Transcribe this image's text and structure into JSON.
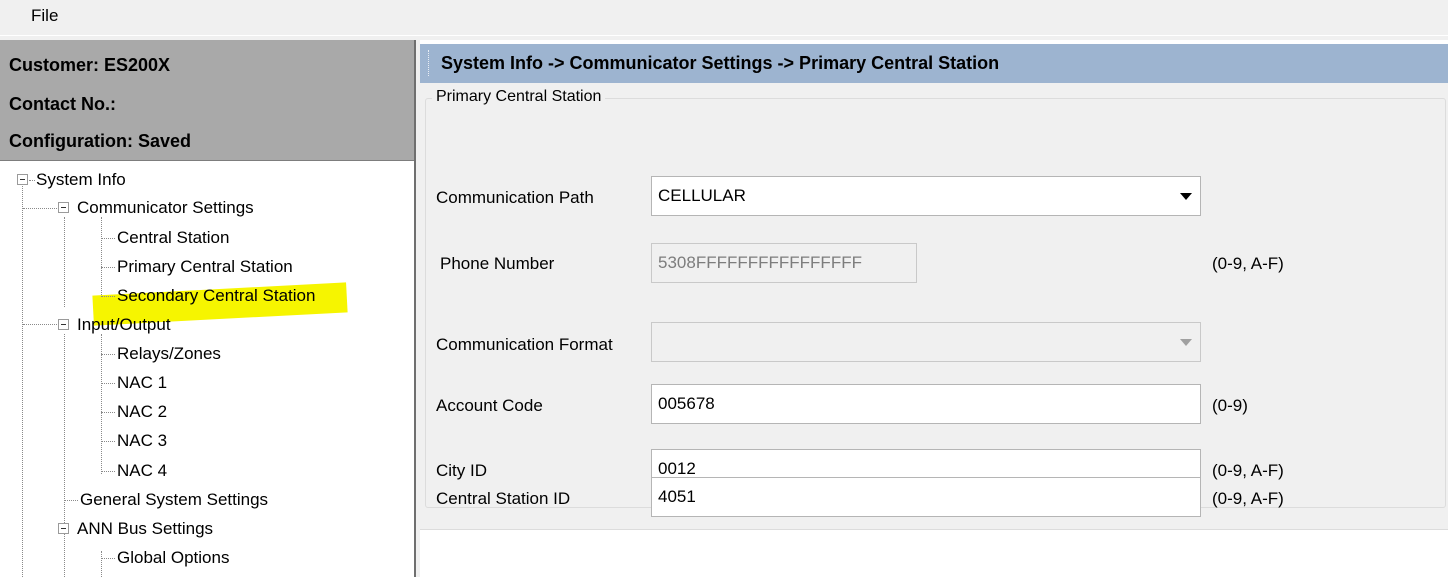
{
  "menu": {
    "file": "File"
  },
  "info": {
    "customer": "Customer: ES200X",
    "contact": "Contact No.:",
    "configuration": "Configuration: Saved"
  },
  "tree": {
    "system_info": "System Info",
    "communicator_settings": "Communicator Settings",
    "central_station": "Central Station",
    "primary_central_station": "Primary Central Station",
    "secondary_central_station": "Secondary Central Station",
    "input_output": "Input/Output",
    "relays_zones": "Relays/Zones",
    "nac1": "NAC 1",
    "nac2": "NAC 2",
    "nac3": "NAC 3",
    "nac4": "NAC 4",
    "general_system_settings": "General System Settings",
    "ann_bus_settings": "ANN Bus Settings",
    "global_options": "Global Options"
  },
  "colors": {
    "selected_highlight": "#f6f500",
    "title_bar": "#9db4d0"
  },
  "header": {
    "title": "System Info -> Communicator Settings -> Primary Central Station"
  },
  "group": {
    "legend": "Primary Central Station"
  },
  "form": {
    "communication_path": {
      "label": "Communication Path",
      "value": "CELLULAR"
    },
    "phone_number": {
      "label": "Phone Number",
      "value": "5308FFFFFFFFFFFFFFFF",
      "hint": "(0-9, A-F)"
    },
    "communication_format": {
      "label": "Communication Format",
      "value": ""
    },
    "account_code": {
      "label": "Account Code",
      "value": "005678",
      "hint": "(0-9)"
    },
    "city_id": {
      "label": "City ID",
      "value": "0012",
      "hint": "(0-9, A-F)"
    },
    "central_station_id": {
      "label": "Central Station ID",
      "value": "4051",
      "hint": "(0-9, A-F)"
    }
  }
}
